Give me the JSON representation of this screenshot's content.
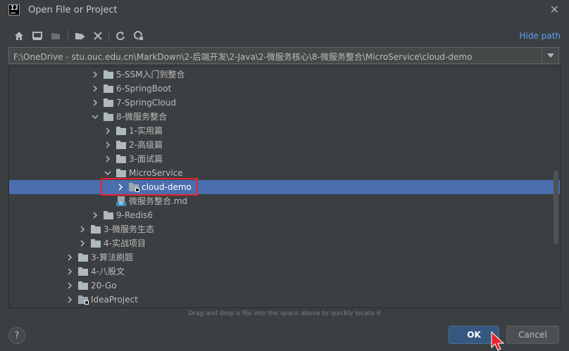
{
  "window": {
    "title": "Open File or Project",
    "icon_text": "IJ"
  },
  "toolbar": {
    "buttons": [
      {
        "name": "home-icon"
      },
      {
        "name": "desktop-icon"
      },
      {
        "name": "project-folder-icon"
      },
      {
        "name": "new-folder-icon"
      },
      {
        "name": "delete-icon"
      },
      {
        "name": "refresh-icon"
      },
      {
        "name": "show-hidden-icon"
      }
    ],
    "hide_path_label": "Hide path"
  },
  "path": {
    "value": "F:\\OneDrive - stu.ouc.edu.cn\\MarkDown\\2-后端开发\\2-Java\\2-微服务核心\\8-微服务整合\\MicroService\\cloud-demo"
  },
  "tree": {
    "rows": [
      {
        "label": "5-SSM入门到整合",
        "depth": 3,
        "expanded": false,
        "type": "folder"
      },
      {
        "label": "6-SpringBoot",
        "depth": 3,
        "expanded": false,
        "type": "folder"
      },
      {
        "label": "7-SpringCloud",
        "depth": 3,
        "expanded": false,
        "type": "folder"
      },
      {
        "label": "8-微服务整合",
        "depth": 3,
        "expanded": true,
        "type": "folder"
      },
      {
        "label": "1-实用篇",
        "depth": 4,
        "expanded": false,
        "type": "folder"
      },
      {
        "label": "2-高级篇",
        "depth": 4,
        "expanded": false,
        "type": "folder"
      },
      {
        "label": "3-面试篇",
        "depth": 4,
        "expanded": false,
        "type": "folder"
      },
      {
        "label": "MicroService",
        "depth": 4,
        "expanded": true,
        "type": "folder"
      },
      {
        "label": "cloud-demo",
        "depth": 5,
        "expanded": false,
        "type": "module",
        "selected": true
      },
      {
        "label": "微服务整合.md",
        "depth": 4,
        "type": "markdown"
      },
      {
        "label": "9-Redis6",
        "depth": 3,
        "expanded": false,
        "type": "folder"
      },
      {
        "label": "3-微服务生态",
        "depth": 2,
        "expanded": false,
        "type": "folder"
      },
      {
        "label": "4-实战项目",
        "depth": 2,
        "expanded": false,
        "type": "folder"
      },
      {
        "label": "3-算法刷题",
        "depth": 1,
        "expanded": false,
        "type": "folder"
      },
      {
        "label": "4-八股文",
        "depth": 1,
        "expanded": false,
        "type": "folder"
      },
      {
        "label": "20-Go",
        "depth": 1,
        "expanded": false,
        "type": "folder"
      },
      {
        "label": "IdeaProject",
        "depth": 1,
        "expanded": false,
        "type": "module"
      }
    ]
  },
  "hint": "Drag and drop a file into the space above to quickly locate it",
  "buttons": {
    "help": "?",
    "ok": "OK",
    "cancel": "Cancel"
  },
  "colors": {
    "background": "#3c3f41",
    "selection": "#4b6eaf",
    "ok_button": "#365880",
    "link": "#589df6",
    "highlight": "#e8232e"
  }
}
